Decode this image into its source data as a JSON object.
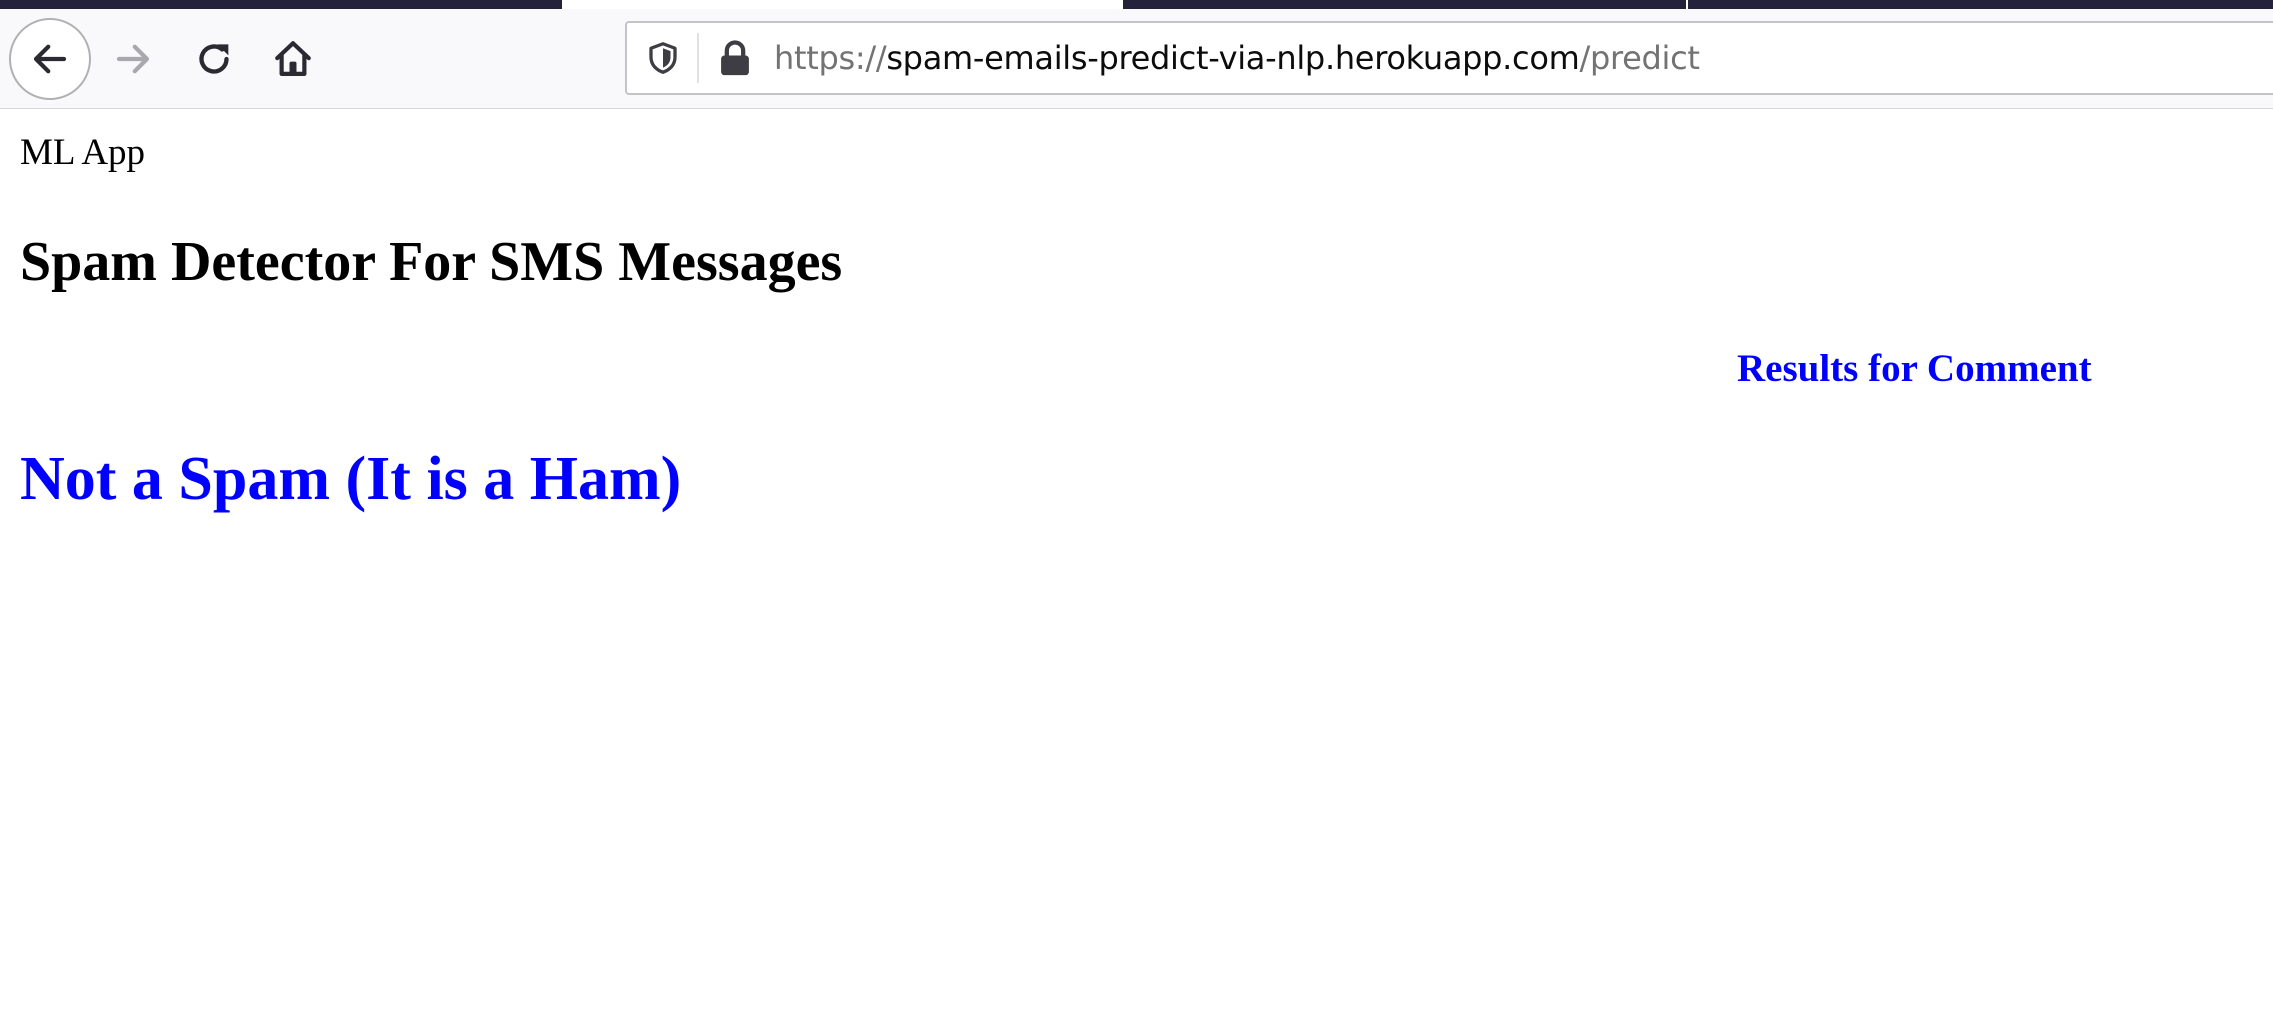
{
  "browser": {
    "url_scheme": "https://",
    "url_host": "spam-emails-predict-via-nlp.herokuapp.com",
    "url_path": "/predict",
    "icons": {
      "back": "arrow-left-icon",
      "forward": "arrow-right-icon",
      "reload": "reload-icon",
      "home": "home-icon",
      "tracking_protection": "shield-icon",
      "security": "lock-icon"
    },
    "colors": {
      "tab_dark": "#23223a",
      "toolbar": "#f9f9fb"
    }
  },
  "page": {
    "app_name": "ML App",
    "title": "Spam Detector For SMS Messages",
    "results_heading": "Results for Comment",
    "prediction": "Not a Spam (It is a Ham)",
    "colors": {
      "result": "#0000ff",
      "text": "#000000"
    }
  }
}
